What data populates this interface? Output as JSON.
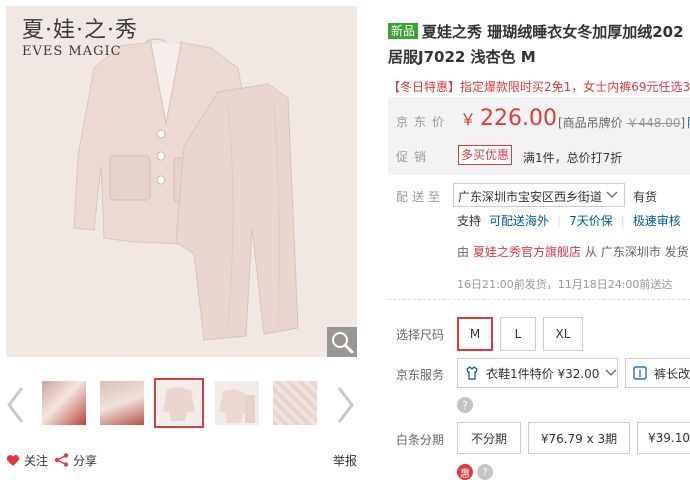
{
  "gallery": {
    "brand_cn": "夏·娃·之·秀",
    "brand_en": "EVES MAGIC",
    "thumb_count": 5,
    "active_thumb": 3,
    "follow_label": "关注",
    "share_label": "分享",
    "report_label": "举报"
  },
  "product": {
    "badge": "新品",
    "title_line1": "夏娃之秀 珊瑚绒睡衣女冬加厚加绒202",
    "title_line2": "居服J7022 浅杏色 M",
    "promo_text": "【冬日特惠】指定爆款限时买2免1，女士内裤69元任选3套"
  },
  "price": {
    "label": "京东价",
    "currency": "￥",
    "value": "226.00",
    "tag_price": "[商品吊牌价 ",
    "tag_strike": "￥448.00",
    "tag_close": "]",
    "tag_tail": "降"
  },
  "promotion": {
    "label": "促销",
    "tag": "多买优惠",
    "desc": "满1件，总价打7折"
  },
  "shipping": {
    "label": "配送至",
    "address": "广东深圳市宝安区西乡街道",
    "stock": "有货",
    "support_label": "支持",
    "support_items": [
      "可配送海外",
      "7天价保",
      "极速审核"
    ],
    "seller_prefix": "由",
    "seller_shop": "夏娃之秀官方旗舰店",
    "seller_suffix": "从 广东深圳市 发货",
    "dispatch": "16日21:00前发货，11月18日24:00前送达"
  },
  "size": {
    "label": "选择尺码",
    "options": [
      "M",
      "L",
      "XL"
    ],
    "selected": "M"
  },
  "service": {
    "label": "京东服务",
    "options": [
      "衣鞋1件特价 ¥32.00",
      "裤长改短"
    ]
  },
  "installment": {
    "label": "白条分期",
    "options": [
      "不分期",
      "¥76.79 x 3期",
      "¥39.10"
    ],
    "bottom_badge": "惠"
  },
  "colors": {
    "accent": "#e4393c",
    "link": "#005aa0",
    "new_badge": "#39a333",
    "price_bg": "#f3f3f3"
  }
}
